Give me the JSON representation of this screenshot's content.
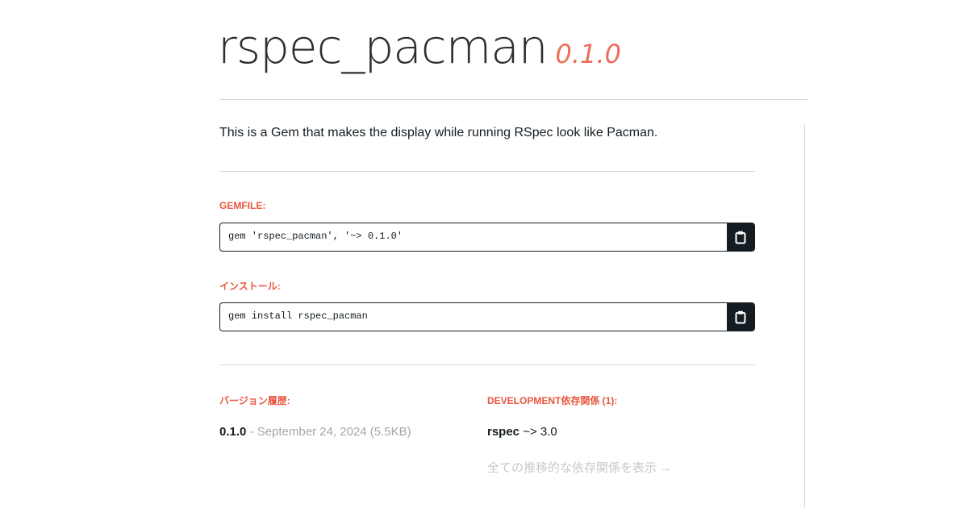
{
  "header": {
    "gem_name": "rspec_pacman",
    "gem_version": "0.1.0"
  },
  "description": "This is a Gem that makes the display while running RSpec look like Pacman.",
  "gemfile": {
    "label": "GEMFILE:",
    "code": "gem 'rspec_pacman', '~> 0.1.0'",
    "copy_icon": "clipboard-icon"
  },
  "install": {
    "label": "インストール:",
    "code": "gem install rspec_pacman",
    "copy_icon": "clipboard-icon"
  },
  "versions": {
    "label": "バージョン履歴:",
    "items": [
      {
        "version": "0.1.0",
        "meta": " - September 24, 2024 (5.5KB)"
      }
    ]
  },
  "dependencies": {
    "label": "DEVELOPMENT依存関係 (1):",
    "items": [
      {
        "name": "rspec",
        "requirement": " ~> 3.0"
      }
    ],
    "all_link": "全ての推移的な依存関係を表示 →"
  },
  "colors": {
    "accent": "#e9573f",
    "text": "#141c22",
    "muted": "#a6a6a6",
    "rule": "#d4d4d4"
  }
}
